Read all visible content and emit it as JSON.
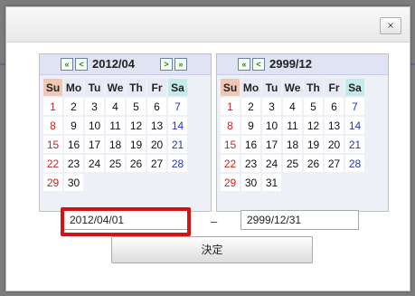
{
  "dialog": {
    "close_label": "×",
    "decide_label": "決定",
    "range_separator": "–"
  },
  "weekdays": [
    "Su",
    "Mo",
    "Tu",
    "We",
    "Th",
    "Fr",
    "Sa"
  ],
  "calendar_left": {
    "title": "2012/04",
    "nav_prev_year": "«",
    "nav_prev_month": "<",
    "nav_next_month": ">",
    "nav_next_year": "»",
    "weeks": [
      [
        "1",
        "2",
        "3",
        "4",
        "5",
        "6",
        "7"
      ],
      [
        "8",
        "9",
        "10",
        "11",
        "12",
        "13",
        "14"
      ],
      [
        "15",
        "16",
        "17",
        "18",
        "19",
        "20",
        "21"
      ],
      [
        "22",
        "23",
        "24",
        "25",
        "26",
        "27",
        "28"
      ],
      [
        "29",
        "30",
        "",
        "",
        "",
        "",
        ""
      ]
    ]
  },
  "calendar_right": {
    "title": "2999/12",
    "nav_prev_year": "«",
    "nav_prev_month": "<",
    "weeks": [
      [
        "1",
        "2",
        "3",
        "4",
        "5",
        "6",
        "7"
      ],
      [
        "8",
        "9",
        "10",
        "11",
        "12",
        "13",
        "14"
      ],
      [
        "15",
        "16",
        "17",
        "18",
        "19",
        "20",
        "21"
      ],
      [
        "22",
        "23",
        "24",
        "25",
        "26",
        "27",
        "28"
      ],
      [
        "29",
        "30",
        "31",
        "",
        "",
        "",
        ""
      ]
    ]
  },
  "inputs": {
    "start_value": "2012/04/01",
    "end_value": "2999/12/31"
  },
  "colors": {
    "highlight": "#d41414",
    "sunday": "#d22020",
    "saturday": "#1d35c9"
  }
}
